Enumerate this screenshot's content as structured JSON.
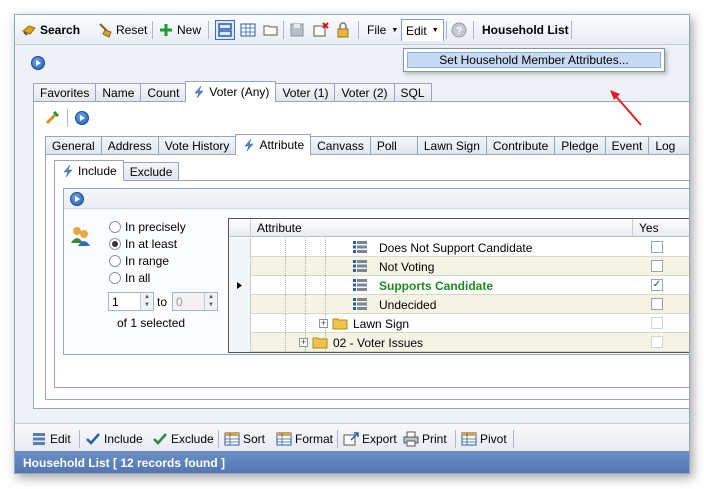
{
  "toolbar": {
    "search": "Search",
    "reset": "Reset",
    "new": "New",
    "file": "File",
    "edit": "Edit",
    "household_list": "Household List"
  },
  "edit_menu": {
    "items": [
      "Set Household Member Attributes..."
    ]
  },
  "main_tabs": [
    "Favorites",
    "Name",
    "Count",
    "Voter (Any)",
    "Voter (1)",
    "Voter (2)",
    "SQL"
  ],
  "sub_tabs": [
    "General",
    "Address",
    "Vote History",
    "Attribute",
    "Canvass",
    "Poll",
    "Lawn Sign",
    "Contribute",
    "Pledge",
    "Event",
    "Log"
  ],
  "include_tabs": [
    "Include",
    "Exclude"
  ],
  "criteria": {
    "options": [
      "In precisely",
      "In at least",
      "In range",
      "In all"
    ],
    "selected": "In at least",
    "from_value": "1",
    "to_label": "to",
    "to_value": "0",
    "selected_summary": "of 1 selected"
  },
  "grid": {
    "columns": [
      "Attribute",
      "Yes"
    ],
    "rows": [
      {
        "label": "Does Not Support Candidate",
        "checked": false,
        "current": false,
        "highlight": false
      },
      {
        "label": "Not Voting",
        "checked": false,
        "current": false,
        "highlight": false
      },
      {
        "label": "Supports Candidate",
        "checked": true,
        "current": true,
        "highlight": true
      },
      {
        "label": "Undecided",
        "checked": false,
        "current": false,
        "highlight": false
      },
      {
        "label": "Lawn Sign",
        "checked": false,
        "current": false,
        "highlight": false
      },
      {
        "label": "02 - Voter Issues",
        "checked": false,
        "current": false,
        "highlight": false
      }
    ]
  },
  "bottom_toolbar": {
    "edit": "Edit",
    "include": "Include",
    "exclude": "Exclude",
    "sort": "Sort",
    "format": "Format",
    "export": "Export",
    "print": "Print",
    "pivot": "Pivot"
  },
  "status": "Household List [ 12 records found ]",
  "colors": {
    "accent": "#1d5bb5",
    "highlight_text": "#1e8a1e",
    "status_bar": "#5a7db8",
    "arrow": "#e02020"
  }
}
